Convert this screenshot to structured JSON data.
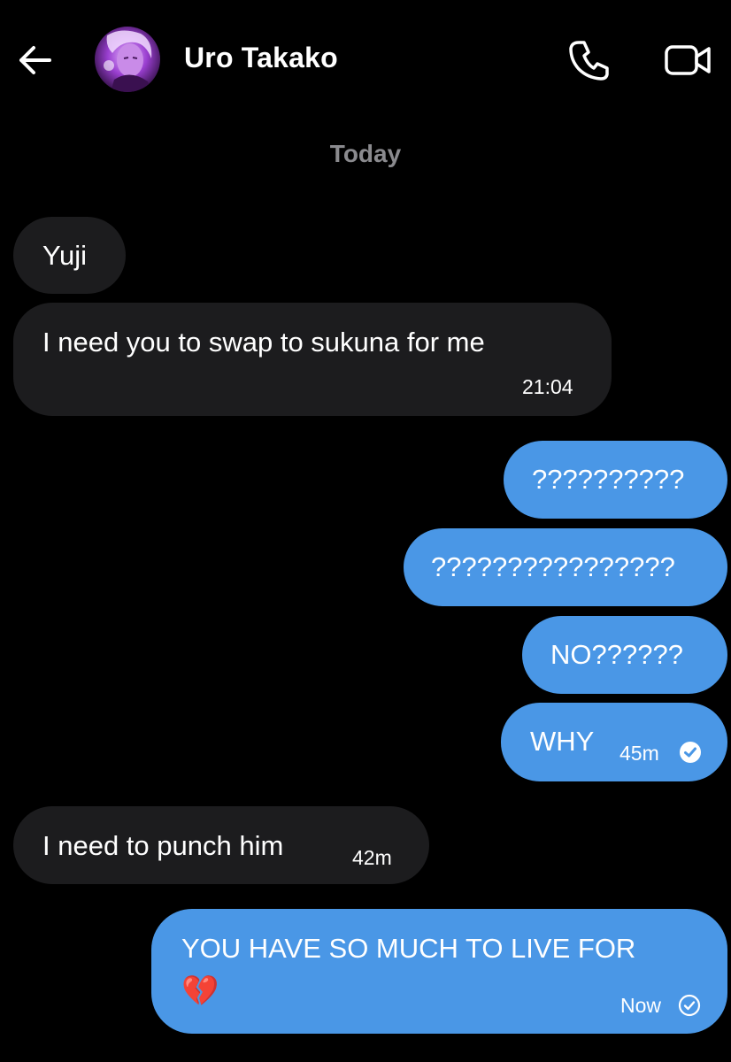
{
  "header": {
    "contact_name": "Uro Takako"
  },
  "date_separator": "Today",
  "messages": [
    {
      "text": "Yuji"
    },
    {
      "text": "I need you to swap to sukuna for me",
      "time": "21:04"
    },
    {
      "text": "??????????"
    },
    {
      "text": "????????????????"
    },
    {
      "text": "NO??????"
    },
    {
      "text": "WHY",
      "time": "45m"
    },
    {
      "text": "I need to punch him",
      "time": "42m"
    },
    {
      "text": "YOU HAVE SO MUCH TO LIVE FOR",
      "emoji": "💔",
      "time": "Now"
    }
  ],
  "icons": [
    "back-arrow-icon",
    "avatar-image",
    "phone-icon",
    "video-camera-icon",
    "read-check-icon",
    "sent-check-icon",
    "broken-heart-emoji"
  ],
  "colors": {
    "background": "#000000",
    "incoming_bubble": "#1c1c1e",
    "outgoing_bubble": "#4a97e6",
    "date_text": "#8a8a8e"
  }
}
